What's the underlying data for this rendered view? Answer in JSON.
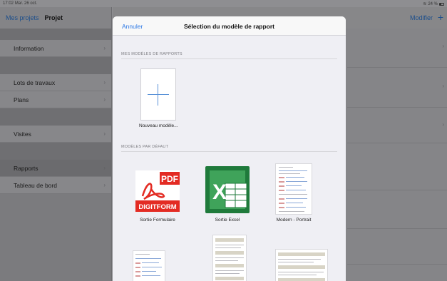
{
  "status_bar": {
    "time": "17:02",
    "date": "Mar. 26 oct.",
    "battery": "24 %"
  },
  "sidebar": {
    "back_label": "Mes projets",
    "title": "Projet",
    "items": [
      {
        "label": "Information"
      },
      {
        "label": "Lots de travaux"
      },
      {
        "label": "Plans"
      },
      {
        "label": "Visites"
      },
      {
        "label": "Rapports"
      },
      {
        "label": "Tableau de bord"
      }
    ]
  },
  "main": {
    "modify_label": "Modifier",
    "add_label": "+"
  },
  "modal": {
    "cancel_label": "Annuler",
    "title": "Sélection du modèle de rapport",
    "my_models_header": "MES MODÈLES DE RAPPORTS",
    "new_model_label": "Nouveau modèle...",
    "default_models_header": "MODÈLES PAR DÉFAUT",
    "default_models": [
      {
        "label": "Sortie Formulaire",
        "logo_text": "PDF",
        "brand_text": "DIGITFORM"
      },
      {
        "label": "Sortie Excel",
        "logo_text": "X"
      },
      {
        "label": "Modern - Portrait"
      }
    ]
  },
  "colors": {
    "accent": "#2f7ae5",
    "pdf_red": "#e32b23",
    "excel_green": "#1f7a3b"
  }
}
